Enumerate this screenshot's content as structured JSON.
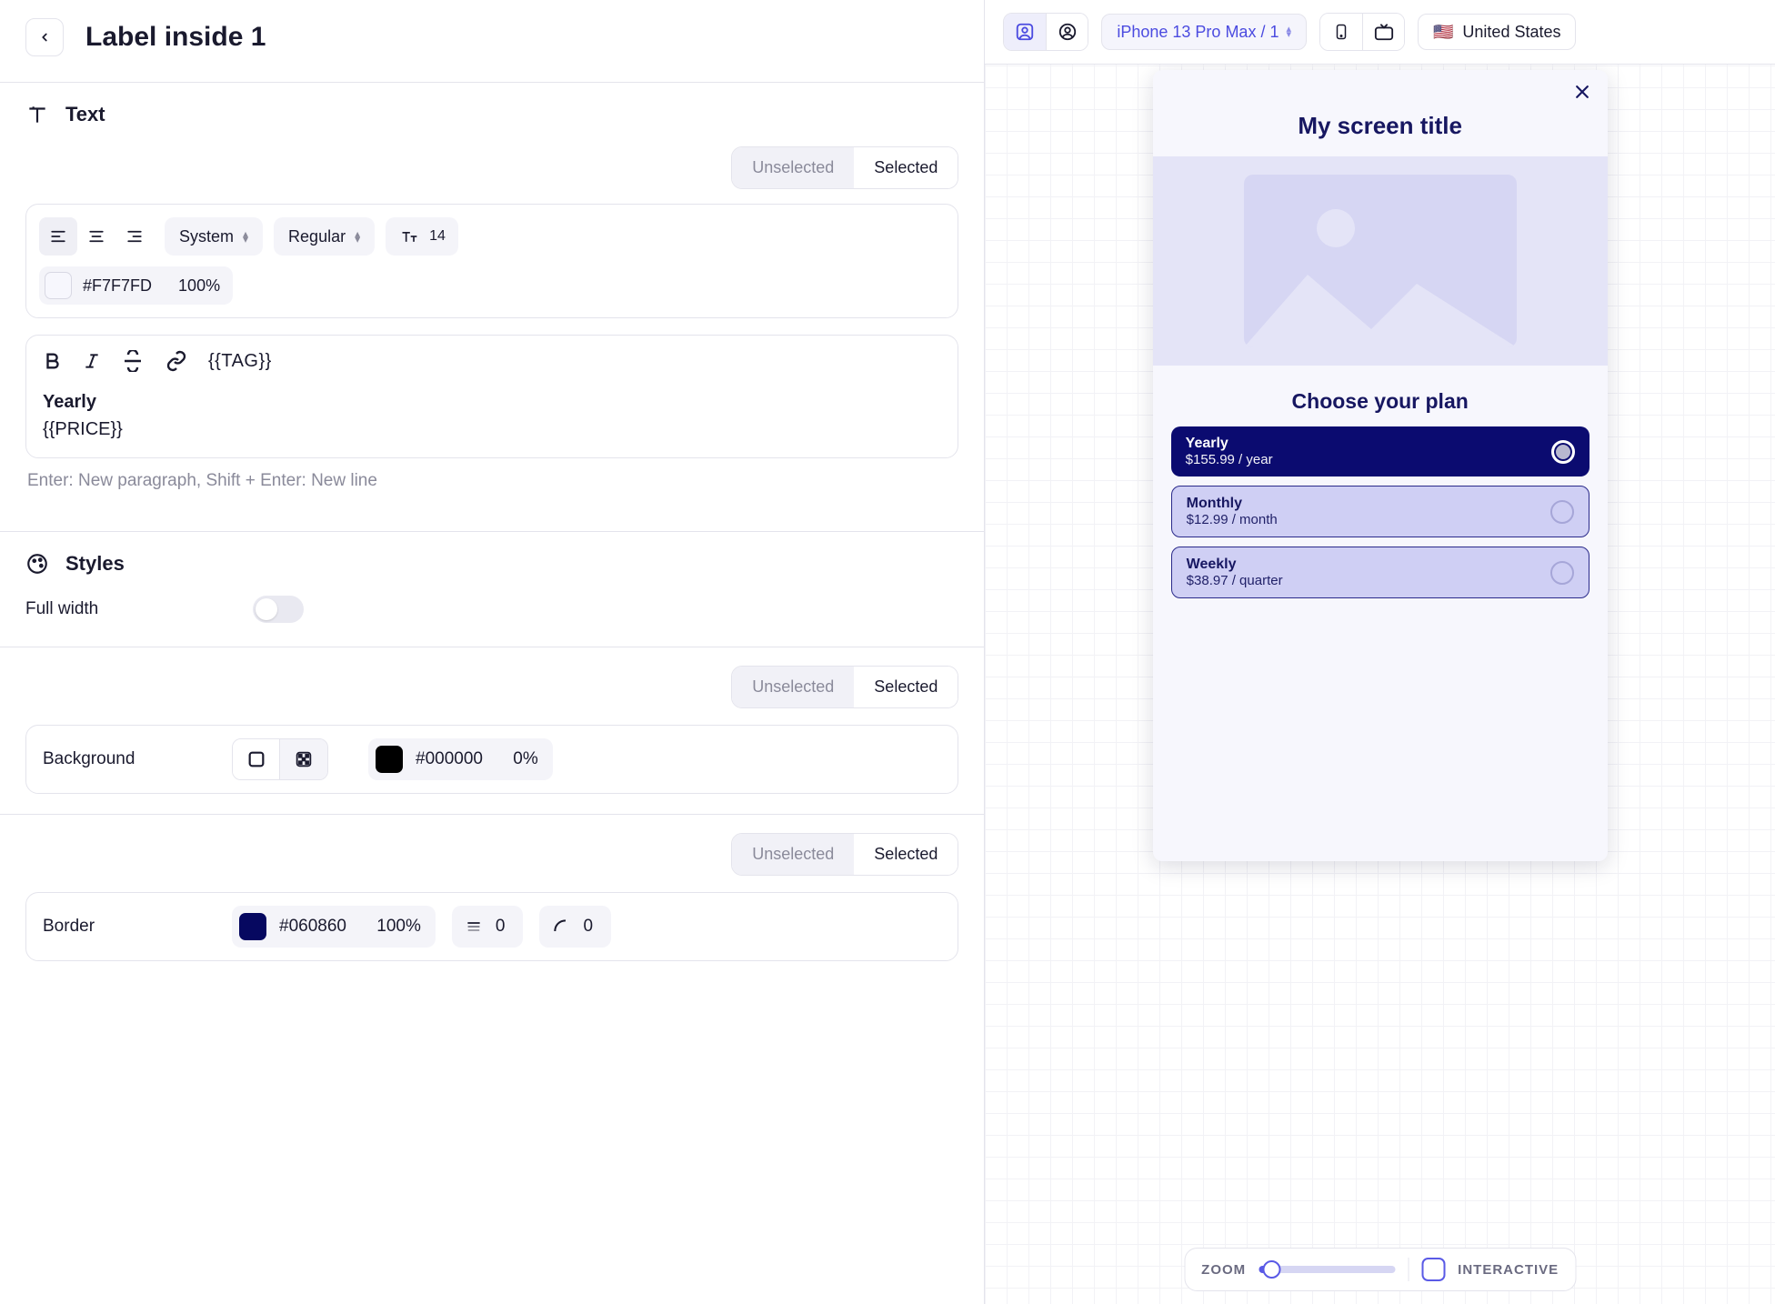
{
  "header": {
    "title": "Label inside 1"
  },
  "section_text": {
    "title": "Text"
  },
  "state_tabs": {
    "unselected": "Unselected",
    "selected": "Selected"
  },
  "text_style": {
    "font_family": "System",
    "font_weight": "Regular",
    "font_size": "14",
    "color_hex": "#F7F7FD",
    "color_opacity": "100%"
  },
  "editor": {
    "tag_token": "{{TAG}}",
    "line1": "Yearly",
    "line2": "{{PRICE}}",
    "hint": "Enter: New paragraph, Shift + Enter: New line"
  },
  "section_styles": {
    "title": "Styles"
  },
  "full_width": {
    "label": "Full width"
  },
  "background": {
    "label": "Background",
    "color_hex": "#000000",
    "opacity": "0%"
  },
  "border": {
    "label": "Border",
    "color_hex": "#060860",
    "opacity": "100%",
    "width": "0",
    "radius": "0"
  },
  "preview_bar": {
    "device": "iPhone 13 Pro Max / 1",
    "country": "United States",
    "flag": "🇺🇸"
  },
  "preview": {
    "screen_title": "My screen title",
    "plan_heading": "Choose your plan",
    "plans": [
      {
        "name": "Yearly",
        "price": "$155.99 / year"
      },
      {
        "name": "Monthly",
        "price": "$12.99 / month"
      },
      {
        "name": "Weekly",
        "price": "$38.97 / quarter"
      }
    ]
  },
  "zoom": {
    "label": "ZOOM",
    "interactive": "INTERACTIVE"
  }
}
